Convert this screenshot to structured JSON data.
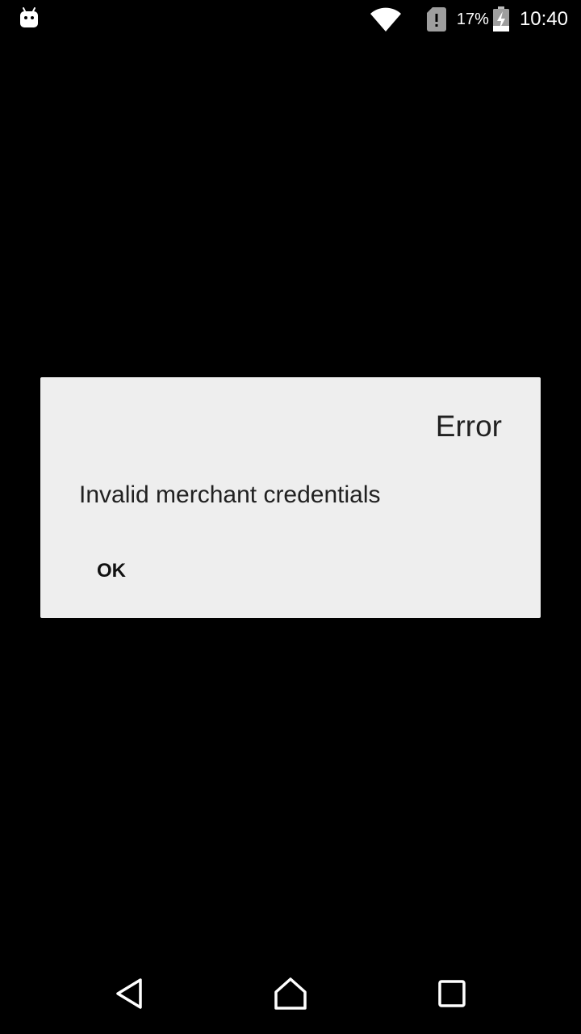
{
  "status_bar": {
    "notification_icon": "android-debug-icon",
    "wifi_icon": "wifi-icon",
    "sim_icon": "sim-alert-icon",
    "battery_percent": "17%",
    "battery_icon": "battery-charging-icon",
    "time": "10:40"
  },
  "dialog": {
    "title": "Error",
    "message": "Invalid merchant credentials",
    "ok_label": "OK"
  },
  "nav_bar": {
    "back_icon": "back-icon",
    "home_icon": "home-icon",
    "recents_icon": "recents-icon"
  },
  "colors": {
    "background": "#000000",
    "dialog_background": "#eeeeee",
    "text": "#212121",
    "status_text": "#ffffff"
  }
}
